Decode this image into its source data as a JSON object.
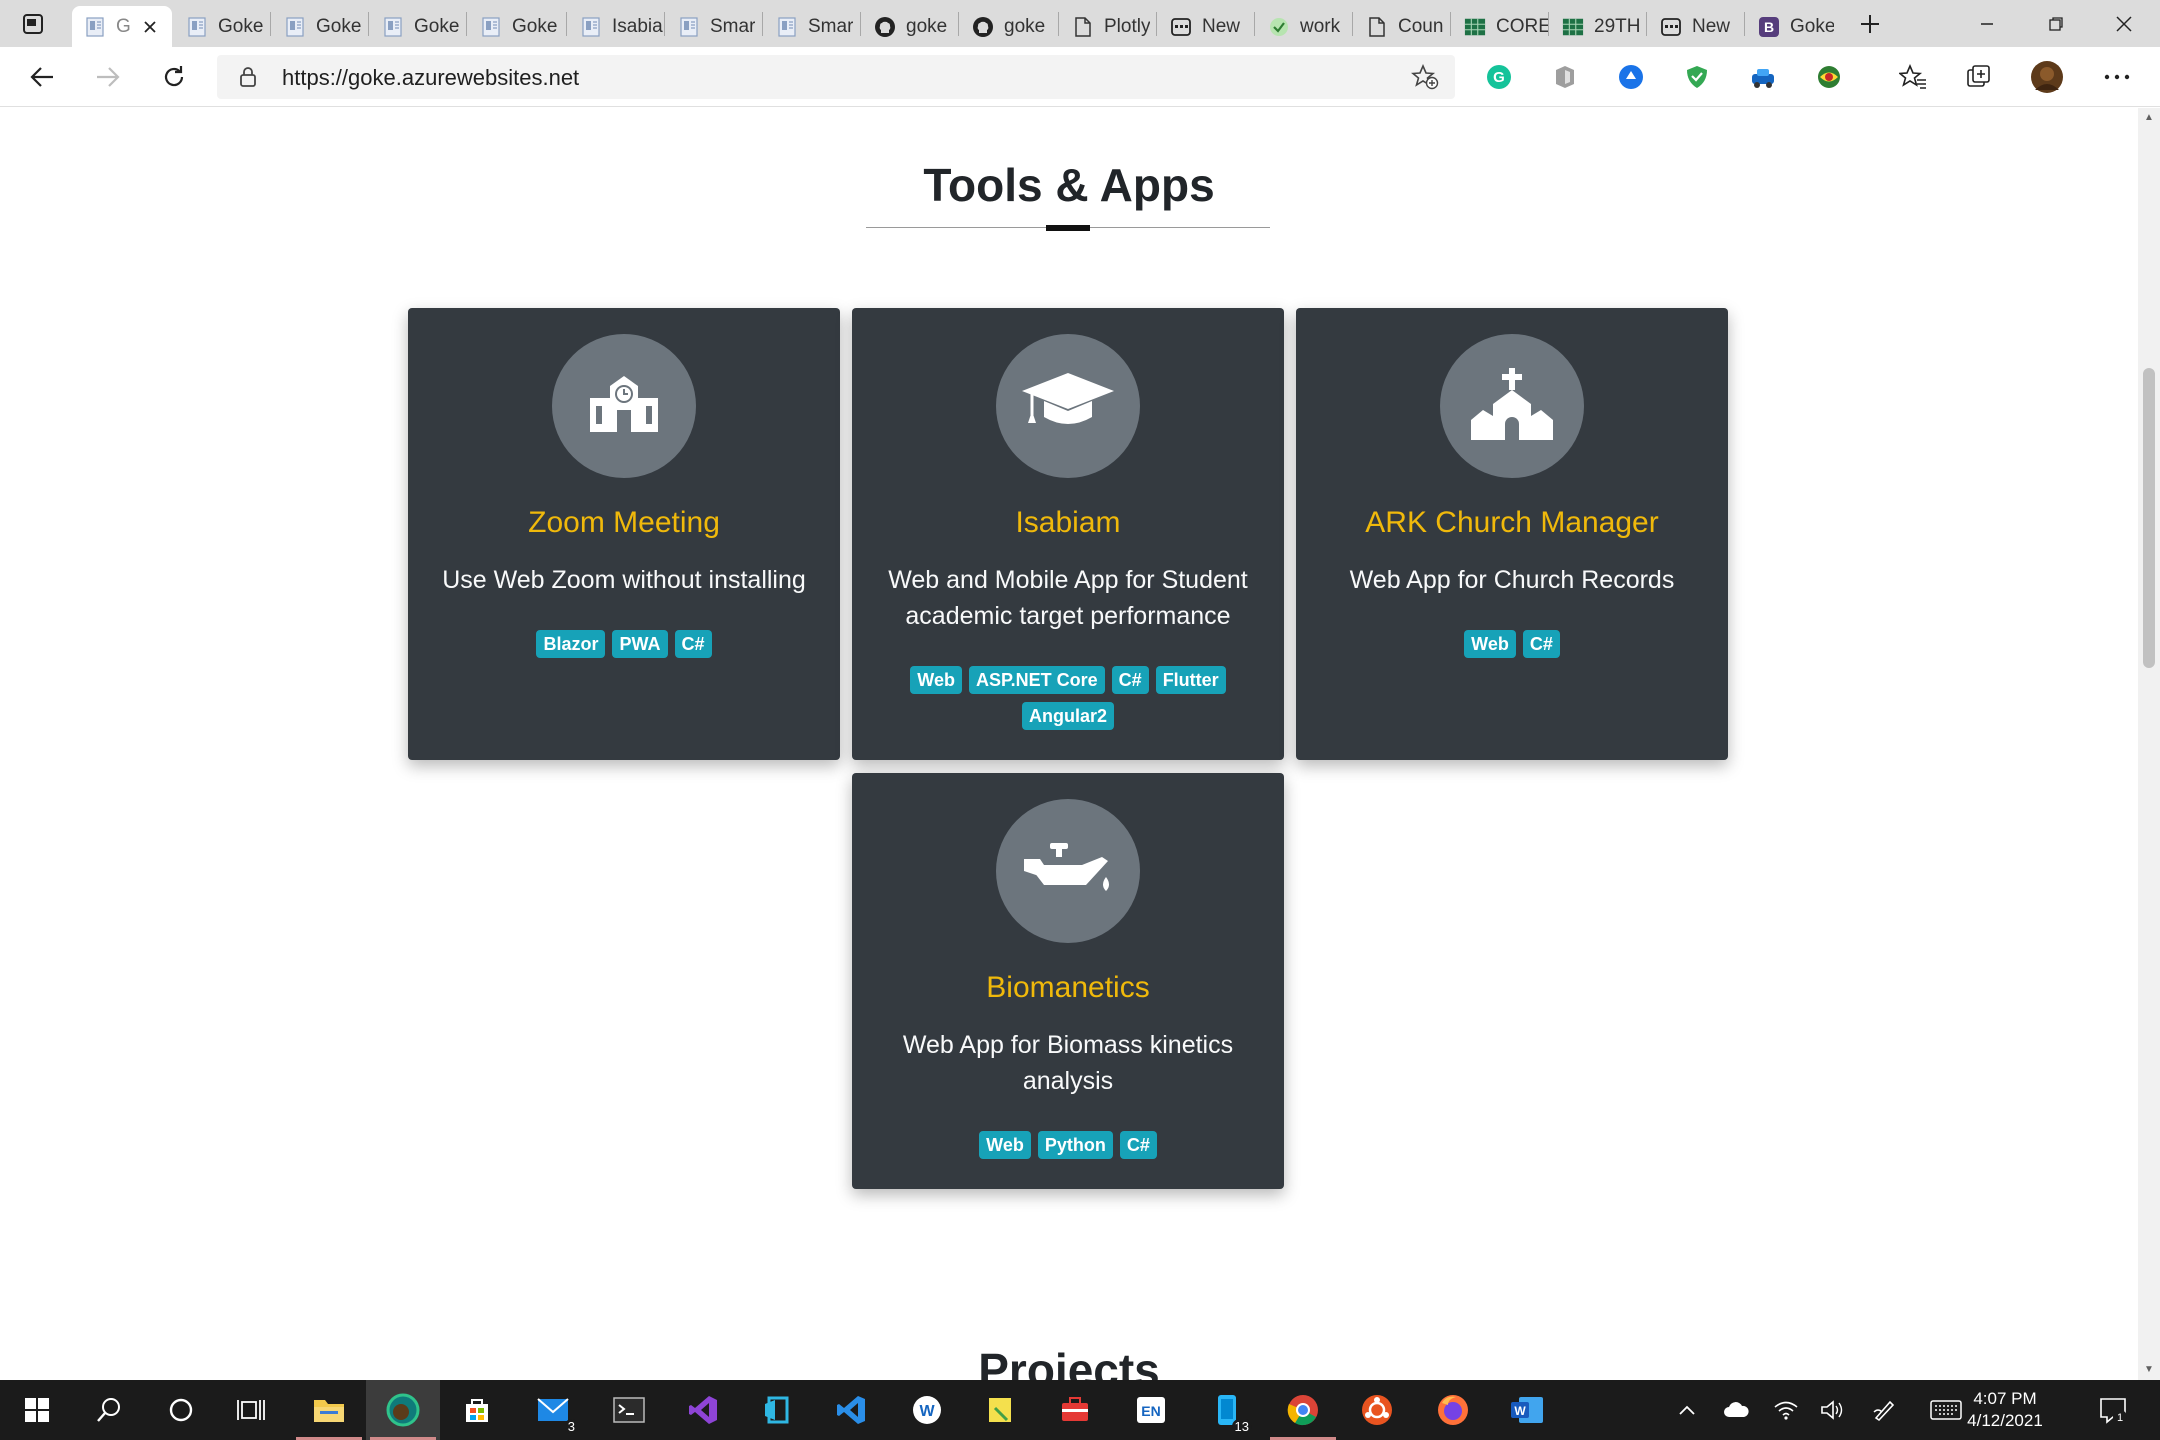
{
  "browser": {
    "tabs": [
      {
        "label": "G",
        "icon": "page-icon",
        "active": true
      },
      {
        "label": "Goke",
        "icon": "page-icon"
      },
      {
        "label": "Goke",
        "icon": "page-icon"
      },
      {
        "label": "Goke",
        "icon": "page-icon"
      },
      {
        "label": "Goke",
        "icon": "page-icon"
      },
      {
        "label": "Isabia",
        "icon": "page-icon"
      },
      {
        "label": "Smar",
        "icon": "page-icon"
      },
      {
        "label": "Smar",
        "icon": "page-icon"
      },
      {
        "label": "goke",
        "icon": "github-icon"
      },
      {
        "label": "goke",
        "icon": "github-icon"
      },
      {
        "label": "Plotly",
        "icon": "document-icon"
      },
      {
        "label": "New",
        "icon": "new-tab-icon"
      },
      {
        "label": "work",
        "icon": "check-badge-icon"
      },
      {
        "label": "Coun",
        "icon": "document-icon"
      },
      {
        "label": "CORE",
        "icon": "sheet-icon"
      },
      {
        "label": "29TH",
        "icon": "sheet-icon"
      },
      {
        "label": "New",
        "icon": "new-tab-icon"
      },
      {
        "label": "Goke",
        "icon": "bootstrap-icon"
      }
    ],
    "url": "https://goke.azurewebsites.net"
  },
  "section": {
    "title": "Tools & Apps"
  },
  "cards": [
    {
      "icon": "school-icon",
      "title": "Zoom Meeting",
      "description": "Use Web Zoom without installing",
      "tags": [
        "Blazor",
        "PWA",
        "C#"
      ]
    },
    {
      "icon": "graduation-cap-icon",
      "title": "Isabiam",
      "description": "Web and Mobile App for Student academic target performance",
      "tags": [
        "Web",
        "ASP.NET Core",
        "C#",
        "Flutter",
        "Angular2"
      ]
    },
    {
      "icon": "church-icon",
      "title": "ARK Church Manager",
      "description": "Web App for Church Records",
      "tags": [
        "Web",
        "C#"
      ]
    },
    {
      "icon": "oil-can-icon",
      "title": "Biomanetics",
      "description": "Web App for Biomass kinetics analysis",
      "tags": [
        "Web",
        "Python",
        "C#"
      ]
    }
  ],
  "next_section": {
    "title": "Projects"
  },
  "taskbar": {
    "mail_count": "3",
    "phone_count": "13",
    "language": "EN",
    "time": "4:07 PM",
    "date": "4/12/2021",
    "notification_count": "1"
  },
  "colors": {
    "card_bg": "#343a40",
    "card_title": "#f0b90b",
    "badge": "#17a2b8",
    "icon_circle": "#6c757d"
  }
}
